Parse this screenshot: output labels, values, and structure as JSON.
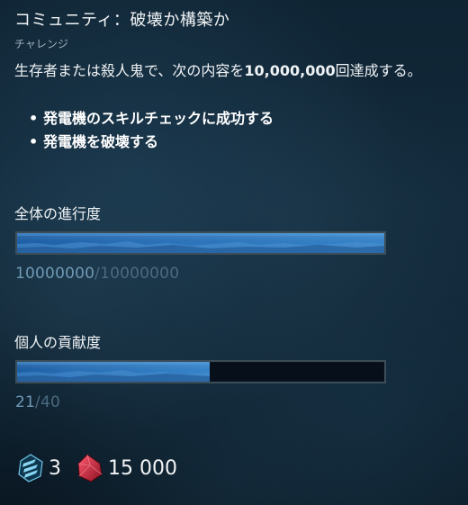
{
  "challenge": {
    "title": "コミュニティ：破壊か構築か",
    "type_label": "チャレンジ",
    "description_prefix": "生存者または殺人鬼で、次の内容を",
    "description_number": "10,000,000",
    "description_suffix": "回達成する。",
    "tasks": [
      "発電機のスキルチェックに成功する",
      "発電機を破壊する"
    ]
  },
  "global_progress": {
    "label": "全体の進行度",
    "current": "10000000",
    "max": "10000000",
    "separator": "/",
    "fraction": 1.0
  },
  "personal_progress": {
    "label": "個人の貢献度",
    "current": "21",
    "max": "40",
    "separator": "/",
    "fraction": 0.525
  },
  "rewards": [
    {
      "icon": "rift-fragment-icon",
      "amount": "3",
      "color": "#6fd3ff"
    },
    {
      "icon": "iridescent-shard-icon",
      "amount": "15 000",
      "color": "#c6203a"
    }
  ]
}
